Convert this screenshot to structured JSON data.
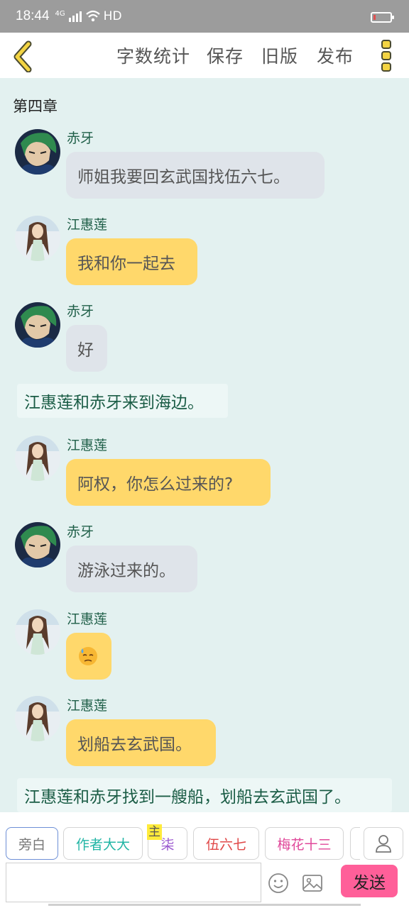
{
  "status_bar": {
    "time": "18:44",
    "network": "4G",
    "hd": "HD"
  },
  "toolbar": {
    "word_count": "字数统计",
    "save": "保存",
    "old_version": "旧版",
    "publish": "发布"
  },
  "chat": {
    "chapter_title": "第四章",
    "messages": [
      {
        "type": "dialog",
        "speaker": "赤牙",
        "avatar": "chiya",
        "color": "grey",
        "text": "师姐我要回玄武国找伍六七。"
      },
      {
        "type": "dialog",
        "speaker": "江惠莲",
        "avatar": "jianghuilian",
        "color": "yellow",
        "text": "我和你一起去"
      },
      {
        "type": "dialog",
        "speaker": "赤牙",
        "avatar": "chiya",
        "color": "grey",
        "text": "好"
      },
      {
        "type": "narration",
        "text": "江惠莲和赤牙来到海边。"
      },
      {
        "type": "dialog",
        "speaker": "江惠莲",
        "avatar": "jianghuilian",
        "color": "yellow",
        "text": "阿权，你怎么过来的?"
      },
      {
        "type": "dialog",
        "speaker": "赤牙",
        "avatar": "chiya",
        "color": "grey",
        "text": "游泳过来的。"
      },
      {
        "type": "dialog",
        "speaker": "江惠莲",
        "avatar": "jianghuilian",
        "color": "yellow",
        "text": "",
        "emoji": "sweat-face"
      },
      {
        "type": "dialog",
        "speaker": "江惠莲",
        "avatar": "jianghuilian",
        "color": "yellow",
        "text": "划船去玄武国。"
      },
      {
        "type": "narration",
        "text": "江惠莲和赤牙找到一艘船，划船去玄武国了。"
      }
    ]
  },
  "character_bar": {
    "chips": [
      {
        "label": "旁白",
        "color": "#777777",
        "active": true
      },
      {
        "label": "作者大大",
        "color": "#22b5a5",
        "active": false
      },
      {
        "label": "柒",
        "color": "#9b59d0",
        "active": false,
        "main_tag": "主"
      },
      {
        "label": "伍六七",
        "color": "#e04848",
        "active": false
      },
      {
        "label": "梅花十三",
        "color": "#e0489a",
        "active": false
      }
    ],
    "input": {
      "value": "",
      "placeholder": ""
    },
    "send": "发送"
  },
  "colors": {
    "background": "#e3f1f0",
    "bubble_grey": "#dfe4ea",
    "bubble_yellow": "#ffd86b",
    "send_button": "#ff5f99",
    "back_arrow": "#f3d443"
  }
}
